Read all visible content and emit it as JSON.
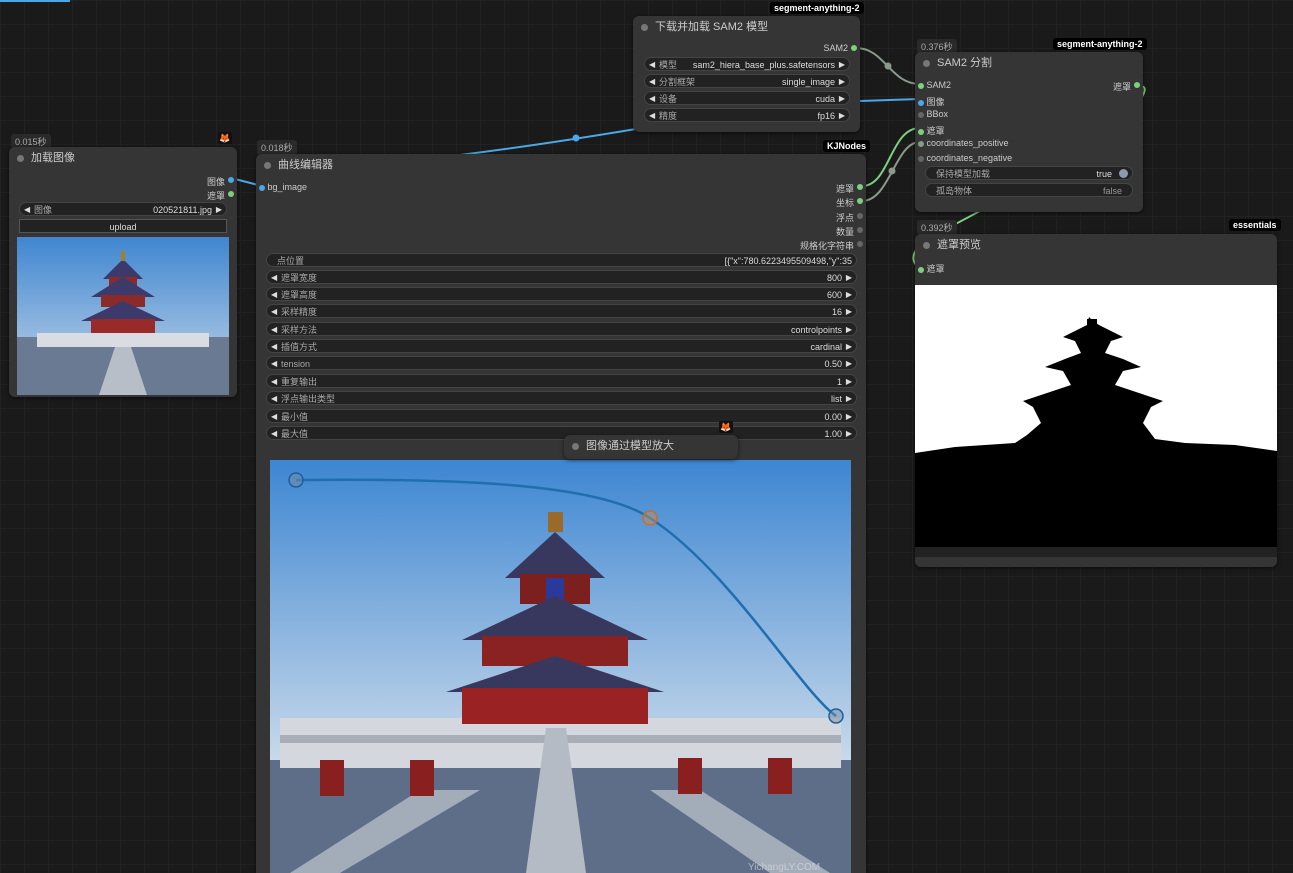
{
  "colors": {
    "accent_blue": "#4aa8e8",
    "accent_green": "#7ecf7e",
    "link_gray": "#8a9a8a"
  },
  "icons": {
    "fox": "fox-icon",
    "node_dot": "circle-icon",
    "arrow_left": "◀",
    "arrow_right": "▶"
  },
  "load_image": {
    "timing": "0.015秒",
    "title": "加载图像",
    "out_image": "图像",
    "out_mask": "遮罩",
    "widget_label": "图像",
    "widget_value": "020521811.jpg",
    "upload": "upload"
  },
  "sam2_loader": {
    "title": "下载并加载 SAM2 模型",
    "badge": "segment-anything-2",
    "out": "SAM2",
    "widgets": [
      {
        "label": "模型",
        "value": "sam2_hiera_base_plus.safetensors"
      },
      {
        "label": "分割框架",
        "value": "single_image"
      },
      {
        "label": "设备",
        "value": "cuda"
      },
      {
        "label": "精度",
        "value": "fp16"
      }
    ]
  },
  "sam2_seg": {
    "timing": "0.376秒",
    "title": "SAM2 分割",
    "badge": "segment-anything-2",
    "inputs": [
      "SAM2",
      "图像",
      "BBox",
      "遮罩",
      "coordinates_positive",
      "coordinates_negative"
    ],
    "out": "遮罩",
    "widgets": [
      {
        "label": "保持模型加载",
        "value": "true"
      },
      {
        "label": "孤岛物体",
        "value": "false"
      }
    ]
  },
  "curve_editor": {
    "timing": "0.018秒",
    "title": "曲线编辑器",
    "badge": "KJNodes",
    "input": "bg_image",
    "outputs": [
      "遮罩",
      "坐标",
      "浮点",
      "数量",
      "规格化字符串"
    ],
    "points_label": "点位置",
    "points_value": "[{\"x\":780.6223495509498,\"y\":35",
    "widgets": [
      {
        "label": "遮罩宽度",
        "value": "800"
      },
      {
        "label": "遮罩高度",
        "value": "600"
      },
      {
        "label": "采样精度",
        "value": "16"
      },
      {
        "label": "采样方法",
        "value": "controlpoints"
      },
      {
        "label": "插值方式",
        "value": "cardinal"
      },
      {
        "label": "tension",
        "value": "0.50"
      },
      {
        "label": "重复输出",
        "value": "1"
      },
      {
        "label": "浮点输出类型",
        "value": "list"
      },
      {
        "label": "最小值",
        "value": "0.00"
      },
      {
        "label": "最大值",
        "value": "1.00"
      }
    ],
    "watermark": "YichangLY.COM"
  },
  "upscale": {
    "title": "图像通过模型放大"
  },
  "mask_preview": {
    "timing": "0.392秒",
    "title": "遮罩预览",
    "badge": "essentials",
    "input": "遮罩"
  }
}
